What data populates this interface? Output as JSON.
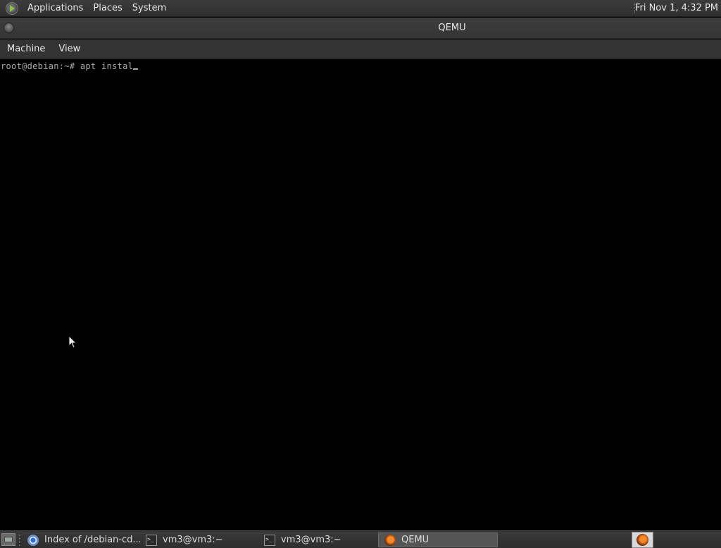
{
  "top_panel": {
    "menu": [
      "Applications",
      "Places",
      "System"
    ],
    "clock": "Fri Nov 1,  4:32 PM"
  },
  "window": {
    "title": "QEMU",
    "menubar": [
      "Machine",
      "View"
    ]
  },
  "console": {
    "prompt": "root@debian:~# ",
    "command": "apt instal"
  },
  "taskbar": {
    "tasks": [
      {
        "label": "Index of /debian-cd...",
        "icon": "chromium-icon",
        "active": false
      },
      {
        "label": "vm3@vm3:~",
        "icon": "terminal-icon",
        "active": false
      },
      {
        "label": "vm3@vm3:~",
        "icon": "terminal-icon",
        "active": false
      },
      {
        "label": "QEMU",
        "icon": "qemu-icon",
        "active": true
      }
    ],
    "tray": [
      "qemu-icon"
    ]
  }
}
